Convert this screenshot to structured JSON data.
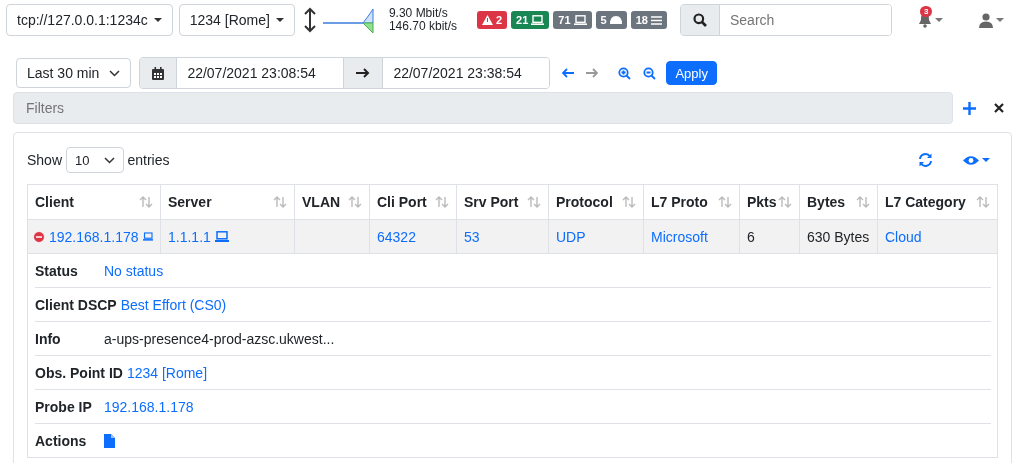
{
  "nav": {
    "interface": "tcp://127.0.0.1:1234c",
    "observation_point": "1234 [Rome]",
    "traffic": {
      "upload": "9.30 Mbit/s",
      "download": "146.70 kbit/s"
    },
    "badges": [
      {
        "kind": "alert",
        "text": "2",
        "color": "#dc3545"
      },
      {
        "kind": "host",
        "text": "21",
        "color": "#198754"
      },
      {
        "kind": "host",
        "text": "71",
        "color": "#6c757d"
      },
      {
        "kind": "device",
        "text": "5",
        "color": "#6c757d"
      },
      {
        "kind": "list",
        "text": "18",
        "color": "#6c757d"
      }
    ],
    "search": {
      "placeholder": "Search"
    },
    "notifications": "3"
  },
  "time": {
    "range": "Last 30 min",
    "begin": "22/07/2021 23:08:54",
    "end": "22/07/2021 23:38:54",
    "apply": "Apply"
  },
  "filters": {
    "placeholder": "Filters"
  },
  "table": {
    "show": "Show",
    "page_size": "10",
    "entries": "entries",
    "columns": [
      "Client",
      "Server",
      "VLAN",
      "Cli Port",
      "Srv Port",
      "Protocol",
      "L7 Proto",
      "Pkts",
      "Bytes",
      "L7 Category"
    ],
    "rows": [
      {
        "expanded": true,
        "cells": [
          {
            "kind": "host",
            "text": "192.168.1.178"
          },
          {
            "kind": "host",
            "text": "1.1.1.1"
          },
          {
            "kind": "plain",
            "text": ""
          },
          {
            "kind": "link",
            "text": "64322"
          },
          {
            "kind": "link",
            "text": "53"
          },
          {
            "kind": "link",
            "text": "UDP"
          },
          {
            "kind": "link",
            "text": "Microsoft"
          },
          {
            "kind": "plain",
            "text": "6"
          },
          {
            "kind": "plain",
            "text": "630 Bytes"
          },
          {
            "kind": "link",
            "text": "Cloud"
          }
        ],
        "details": [
          {
            "kind": "link",
            "label": "Status",
            "value": "No status"
          },
          {
            "kind": "link",
            "label": "Client DSCP",
            "value": "Best Effort (CS0)"
          },
          {
            "kind": "text",
            "label": "Info",
            "value": "a-ups-presence4-prod-azsc.ukwest..."
          },
          {
            "kind": "link",
            "label": "Obs. Point ID",
            "value": "1234 [Rome]"
          },
          {
            "kind": "link",
            "label": "Probe IP",
            "value": "192.168.1.178"
          },
          {
            "kind": "action",
            "label": "Actions"
          }
        ]
      }
    ]
  }
}
